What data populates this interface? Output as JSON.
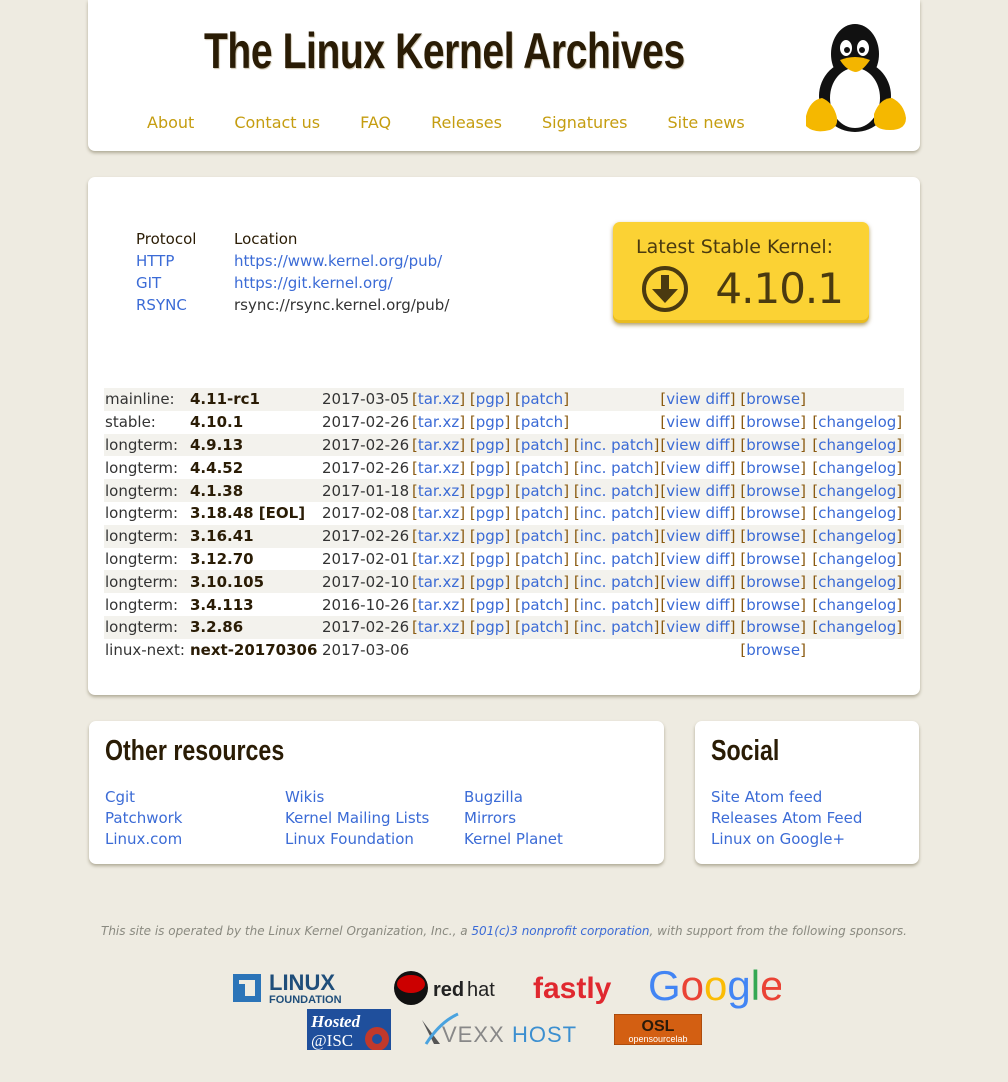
{
  "header": {
    "title": "The Linux Kernel Archives",
    "nav": [
      "About",
      "Contact us",
      "FAQ",
      "Releases",
      "Signatures",
      "Site news"
    ],
    "logo": "tux-penguin"
  },
  "protocols": {
    "headers": [
      "Protocol",
      "Location"
    ],
    "rows": [
      {
        "protocol": "HTTP",
        "location": "https://www.kernel.org/pub/",
        "location_is_link": true
      },
      {
        "protocol": "GIT",
        "location": "https://git.kernel.org/",
        "location_is_link": true
      },
      {
        "protocol": "RSYNC",
        "location": "rsync://rsync.kernel.org/pub/",
        "location_is_link": false
      }
    ]
  },
  "latest_stable": {
    "label": "Latest Stable Kernel:",
    "version": "4.10.1",
    "icon": "download-circle-icon"
  },
  "releases": [
    {
      "kind": "mainline:",
      "version": "4.11-rc1",
      "date": "2017-03-05",
      "links": [
        "tar.xz",
        "pgp",
        "patch"
      ],
      "diff": "view diff",
      "browse": "browse",
      "changelog": null
    },
    {
      "kind": "stable:",
      "version": "4.10.1",
      "date": "2017-02-26",
      "links": [
        "tar.xz",
        "pgp",
        "patch"
      ],
      "diff": "view diff",
      "browse": "browse",
      "changelog": "changelog"
    },
    {
      "kind": "longterm:",
      "version": "4.9.13",
      "date": "2017-02-26",
      "links": [
        "tar.xz",
        "pgp",
        "patch",
        "inc. patch"
      ],
      "diff": "view diff",
      "browse": "browse",
      "changelog": "changelog"
    },
    {
      "kind": "longterm:",
      "version": "4.4.52",
      "date": "2017-02-26",
      "links": [
        "tar.xz",
        "pgp",
        "patch",
        "inc. patch"
      ],
      "diff": "view diff",
      "browse": "browse",
      "changelog": "changelog"
    },
    {
      "kind": "longterm:",
      "version": "4.1.38",
      "date": "2017-01-18",
      "links": [
        "tar.xz",
        "pgp",
        "patch",
        "inc. patch"
      ],
      "diff": "view diff",
      "browse": "browse",
      "changelog": "changelog"
    },
    {
      "kind": "longterm:",
      "version": "3.18.48 [EOL]",
      "date": "2017-02-08",
      "links": [
        "tar.xz",
        "pgp",
        "patch",
        "inc. patch"
      ],
      "diff": "view diff",
      "browse": "browse",
      "changelog": "changelog"
    },
    {
      "kind": "longterm:",
      "version": "3.16.41",
      "date": "2017-02-26",
      "links": [
        "tar.xz",
        "pgp",
        "patch",
        "inc. patch"
      ],
      "diff": "view diff",
      "browse": "browse",
      "changelog": "changelog"
    },
    {
      "kind": "longterm:",
      "version": "3.12.70",
      "date": "2017-02-01",
      "links": [
        "tar.xz",
        "pgp",
        "patch",
        "inc. patch"
      ],
      "diff": "view diff",
      "browse": "browse",
      "changelog": "changelog"
    },
    {
      "kind": "longterm:",
      "version": "3.10.105",
      "date": "2017-02-10",
      "links": [
        "tar.xz",
        "pgp",
        "patch",
        "inc. patch"
      ],
      "diff": "view diff",
      "browse": "browse",
      "changelog": "changelog"
    },
    {
      "kind": "longterm:",
      "version": "3.4.113",
      "date": "2016-10-26",
      "links": [
        "tar.xz",
        "pgp",
        "patch",
        "inc. patch"
      ],
      "diff": "view diff",
      "browse": "browse",
      "changelog": "changelog"
    },
    {
      "kind": "longterm:",
      "version": "3.2.86",
      "date": "2017-02-26",
      "links": [
        "tar.xz",
        "pgp",
        "patch",
        "inc. patch"
      ],
      "diff": "view diff",
      "browse": "browse",
      "changelog": "changelog"
    },
    {
      "kind": "linux-next:",
      "version": "next-20170306",
      "date": "2017-03-06",
      "links": [],
      "diff": null,
      "browse": "browse",
      "changelog": null
    }
  ],
  "other_resources": {
    "title": "Other resources",
    "links": [
      "Cgit",
      "Wikis",
      "Bugzilla",
      "Patchwork",
      "Kernel Mailing Lists",
      "Mirrors",
      "Linux.com",
      "Linux Foundation",
      "Kernel Planet"
    ]
  },
  "social": {
    "title": "Social",
    "links": [
      "Site Atom feed",
      "Releases Atom Feed",
      "Linux on Google+"
    ]
  },
  "footer": {
    "text_before": "This site is operated by the Linux Kernel Organization, Inc., a ",
    "link": "501(c)3 nonprofit corporation",
    "text_after": ", with support from the following sponsors.",
    "sponsors": [
      "Linux Foundation",
      "Red Hat",
      "Fastly",
      "Google",
      "Hosted@ISC",
      "VEXXHOST",
      "OSL opensourcelab"
    ]
  },
  "colors": {
    "background": "#eeebe1",
    "nav_link": "#c59d10",
    "link": "#3b6bd6",
    "title": "#2a1c05",
    "stable_box": "#fbd234"
  }
}
